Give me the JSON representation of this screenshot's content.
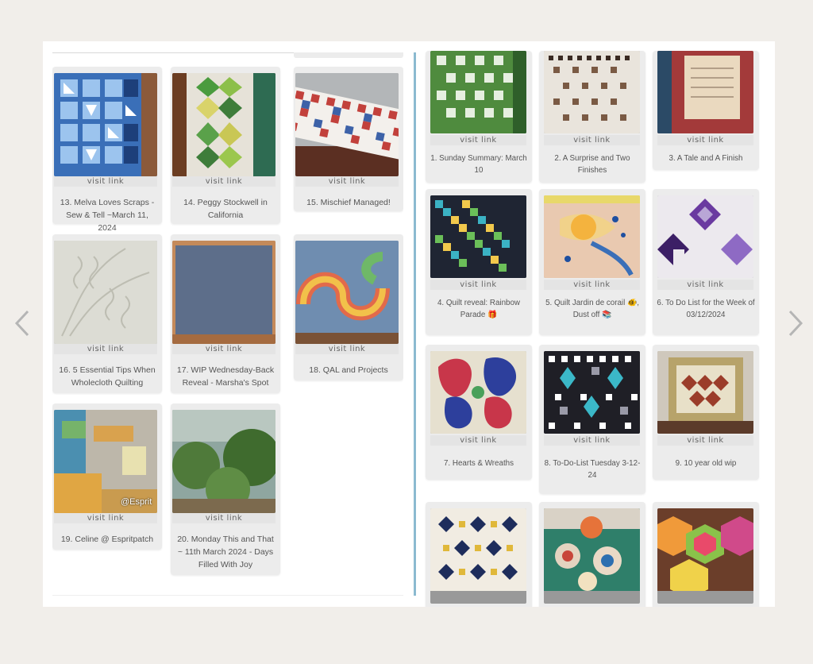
{
  "visit_label": "visit link",
  "left_entries": [
    {
      "caption": "13. Melva Loves Scraps - Sew & Tell ~March 11, 2024"
    },
    {
      "caption": "14. Peggy Stockwell in California"
    },
    {
      "caption": "15. Mischief Managed!"
    },
    {
      "caption": "16. 5 Essential Tips When Wholecloth Quilting"
    },
    {
      "caption": "17. WIP Wednesday-Back Reveal - Marsha's Spot"
    },
    {
      "caption": "18. QAL and Projects"
    },
    {
      "caption": "19. Celine @ Espritpatch",
      "watermark": "@Esprit"
    },
    {
      "caption": "20. Monday This and That ~ 11th March 2024 - Days Filled With Joy"
    }
  ],
  "right_entries": [
    {
      "caption": "1. Sunday Summary: March 10"
    },
    {
      "caption": "2. A Surprise and Two Finishes"
    },
    {
      "caption": "3. A Tale and A Finish"
    },
    {
      "caption": "4. Quilt reveal: Rainbow Parade 🎁"
    },
    {
      "caption": "5. Quilt Jardin de corail 🐠, Dust off 📚"
    },
    {
      "caption": "6. To Do List for the Week of 03/12/2024"
    },
    {
      "caption": "7. Hearts & Wreaths"
    },
    {
      "caption": "8. To-Do-List Tuesday 3-12-24"
    },
    {
      "caption": "9. 10 year old wip"
    },
    {
      "caption": ""
    },
    {
      "caption": ""
    },
    {
      "caption": ""
    }
  ],
  "colors": {
    "page_background": "#f1eeea",
    "divider": "#8bbad0",
    "arrow": "#b5b5b5"
  }
}
